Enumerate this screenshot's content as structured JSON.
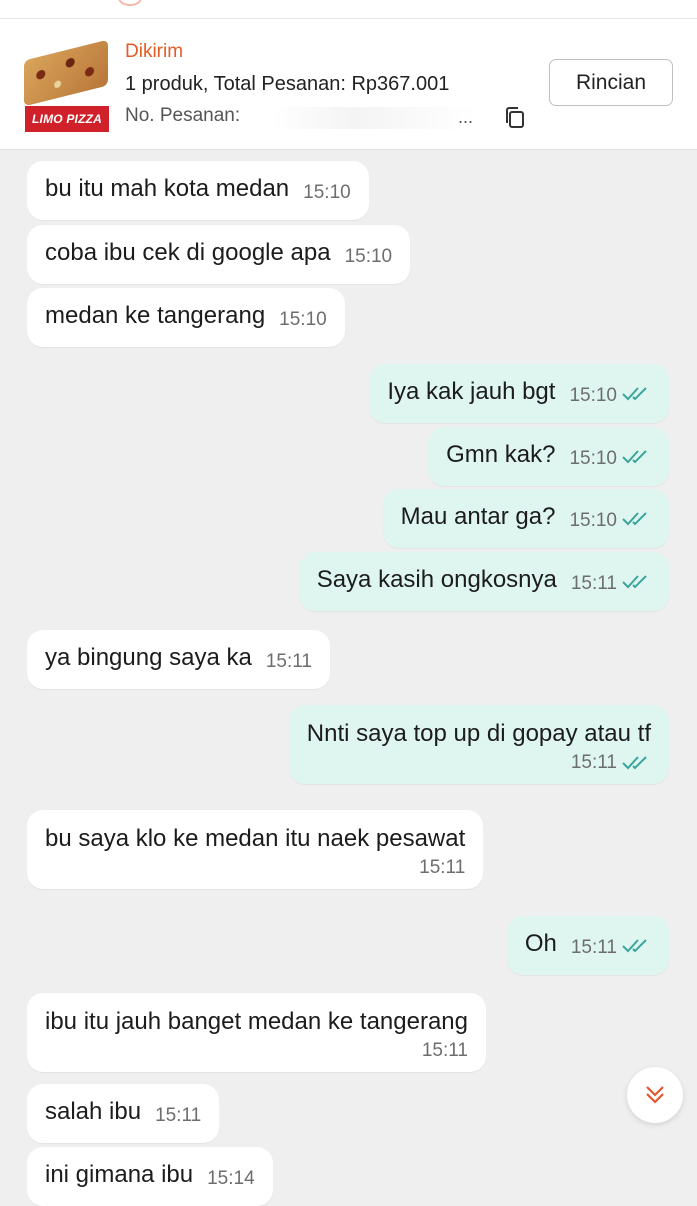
{
  "order": {
    "status": "Dikirim",
    "summary": "1 produk, Total Pesanan: Rp367.001",
    "order_no_label": "No. Pesanan:",
    "order_no_suffix": "...",
    "details_button": "Rincian",
    "brand_logo_text": "LIMO PIZZA"
  },
  "colors": {
    "accent": "#e45b26",
    "outgoing_bubble": "#dff6f0",
    "incoming_bubble": "#ffffff",
    "read_ticks": "#3aa59a",
    "background": "#efefef"
  },
  "messages": [
    {
      "dir": "in",
      "text": "bu itu mah kota medan",
      "time": "15:10"
    },
    {
      "dir": "in",
      "text": "coba ibu cek di google apa",
      "time": "15:10"
    },
    {
      "dir": "in",
      "text": "medan ke tangerang",
      "time": "15:10"
    },
    {
      "dir": "out",
      "text": "Iya kak jauh bgt",
      "time": "15:10"
    },
    {
      "dir": "out",
      "text": "Gmn kak?",
      "time": "15:10"
    },
    {
      "dir": "out",
      "text": "Mau antar ga?",
      "time": "15:10"
    },
    {
      "dir": "out",
      "text": "Saya kasih ongkosnya",
      "time": "15:11"
    },
    {
      "dir": "in",
      "text": "ya bingung saya ka",
      "time": "15:11"
    },
    {
      "dir": "out",
      "text": "Nnti saya top up di gopay atau tf",
      "time": "15:11"
    },
    {
      "dir": "in",
      "text": "bu saya klo ke medan itu naek pesawat",
      "time": "15:11"
    },
    {
      "dir": "out",
      "text": "Oh",
      "time": "15:11"
    },
    {
      "dir": "in",
      "text": "ibu itu jauh banget medan ke tangerang",
      "time": "15:11"
    },
    {
      "dir": "in",
      "text": "salah ibu",
      "time": "15:11"
    },
    {
      "dir": "in",
      "text": "ini gimana ibu",
      "time": "15:14"
    }
  ],
  "icons": {
    "copy": "copy-icon",
    "read_receipt": "double-check-icon",
    "scroll_down": "double-chevron-down-icon"
  }
}
